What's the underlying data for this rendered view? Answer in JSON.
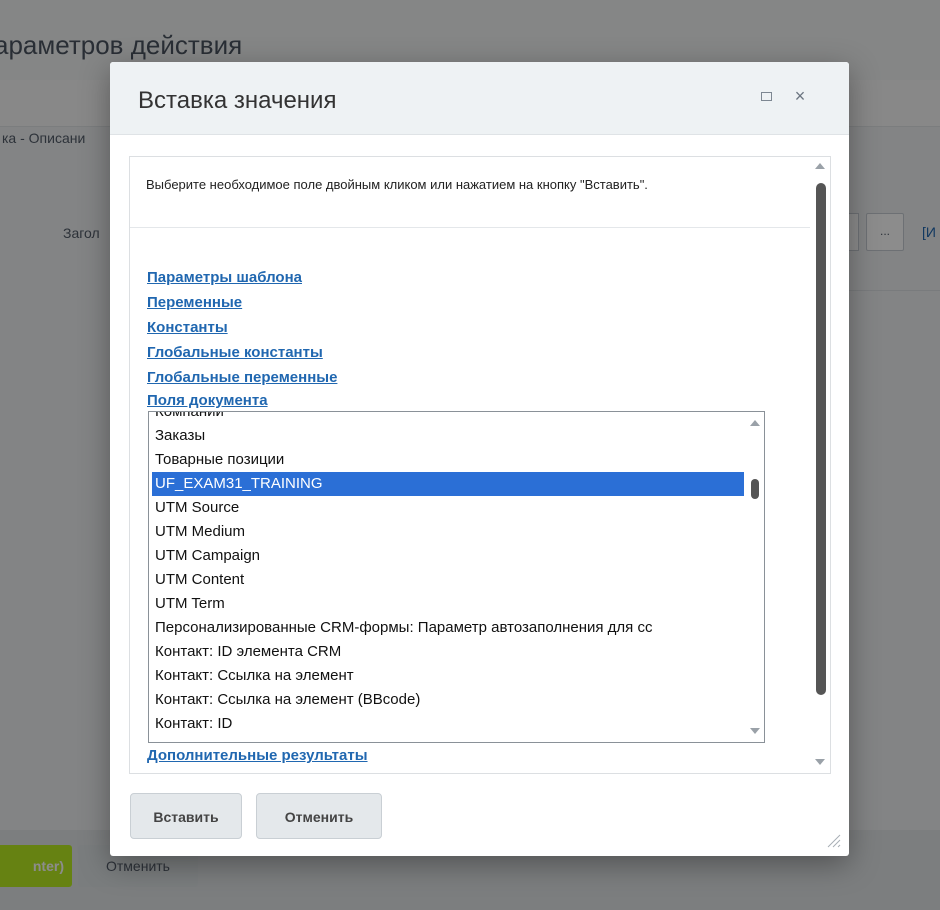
{
  "background": {
    "title": "араметров действия",
    "breadcrumb": "ка - Описани",
    "field_label": "Загол",
    "dots_label": "...",
    "bracket_text": "[И",
    "save_label": "nter)",
    "cancel_label": "Отменить"
  },
  "dialog": {
    "title": "Вставка значения",
    "maximize_icon": "maximize-icon",
    "close_icon": "close-icon",
    "close_glyph": "×",
    "hint": "Выберите необходимое поле двойным кликом или нажатием на кнопку \"Вставить\".",
    "links": [
      "Параметры шаблона",
      "Переменные",
      "Константы",
      "Глобальные константы",
      "Глобальные переменные",
      "Поля документа"
    ],
    "listbox_items": [
      "Компании",
      "Заказы",
      "Товарные позиции",
      "UF_EXAM31_TRAINING",
      "UTM Source",
      "UTM Medium",
      "UTM Campaign",
      "UTM Content",
      "UTM Term",
      "Персонализированные CRM-формы: Параметр автозаполнения для сс",
      "Контакт: ID элемента CRM",
      "Контакт: Ссылка на элемент",
      "Контакт: Ссылка на элемент (BBcode)",
      "Контакт: ID"
    ],
    "selected_item": "UF_EXAM31_TRAINING",
    "extra_link": "Дополнительные результаты",
    "insert_button": "Вставить",
    "cancel_button": "Отменить",
    "colors": {
      "link": "#2067b0",
      "selection": "#2b6fd6",
      "bg_save": "#bbed21"
    }
  }
}
